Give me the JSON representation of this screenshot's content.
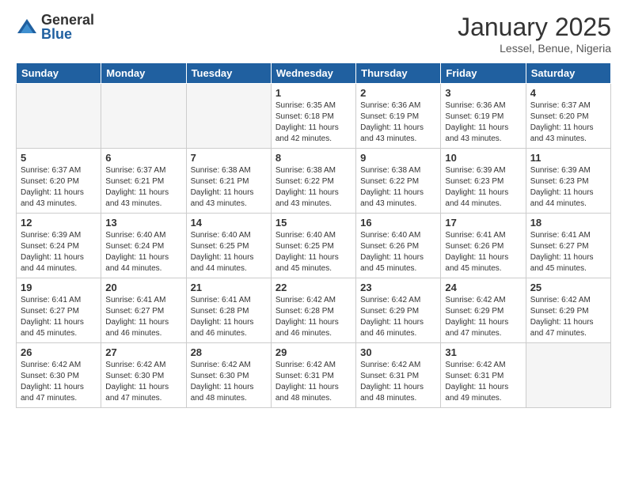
{
  "logo": {
    "general": "General",
    "blue": "Blue"
  },
  "header": {
    "month_year": "January 2025",
    "location": "Lessel, Benue, Nigeria"
  },
  "weekdays": [
    "Sunday",
    "Monday",
    "Tuesday",
    "Wednesday",
    "Thursday",
    "Friday",
    "Saturday"
  ],
  "weeks": [
    [
      {
        "day": "",
        "empty": true
      },
      {
        "day": "",
        "empty": true
      },
      {
        "day": "",
        "empty": true
      },
      {
        "day": "1",
        "sunrise": "6:35 AM",
        "sunset": "6:18 PM",
        "daylight": "11 hours and 42 minutes."
      },
      {
        "day": "2",
        "sunrise": "6:36 AM",
        "sunset": "6:19 PM",
        "daylight": "11 hours and 43 minutes."
      },
      {
        "day": "3",
        "sunrise": "6:36 AM",
        "sunset": "6:19 PM",
        "daylight": "11 hours and 43 minutes."
      },
      {
        "day": "4",
        "sunrise": "6:37 AM",
        "sunset": "6:20 PM",
        "daylight": "11 hours and 43 minutes."
      }
    ],
    [
      {
        "day": "5",
        "sunrise": "6:37 AM",
        "sunset": "6:20 PM",
        "daylight": "11 hours and 43 minutes."
      },
      {
        "day": "6",
        "sunrise": "6:37 AM",
        "sunset": "6:21 PM",
        "daylight": "11 hours and 43 minutes."
      },
      {
        "day": "7",
        "sunrise": "6:38 AM",
        "sunset": "6:21 PM",
        "daylight": "11 hours and 43 minutes."
      },
      {
        "day": "8",
        "sunrise": "6:38 AM",
        "sunset": "6:22 PM",
        "daylight": "11 hours and 43 minutes."
      },
      {
        "day": "9",
        "sunrise": "6:38 AM",
        "sunset": "6:22 PM",
        "daylight": "11 hours and 43 minutes."
      },
      {
        "day": "10",
        "sunrise": "6:39 AM",
        "sunset": "6:23 PM",
        "daylight": "11 hours and 44 minutes."
      },
      {
        "day": "11",
        "sunrise": "6:39 AM",
        "sunset": "6:23 PM",
        "daylight": "11 hours and 44 minutes."
      }
    ],
    [
      {
        "day": "12",
        "sunrise": "6:39 AM",
        "sunset": "6:24 PM",
        "daylight": "11 hours and 44 minutes."
      },
      {
        "day": "13",
        "sunrise": "6:40 AM",
        "sunset": "6:24 PM",
        "daylight": "11 hours and 44 minutes."
      },
      {
        "day": "14",
        "sunrise": "6:40 AM",
        "sunset": "6:25 PM",
        "daylight": "11 hours and 44 minutes."
      },
      {
        "day": "15",
        "sunrise": "6:40 AM",
        "sunset": "6:25 PM",
        "daylight": "11 hours and 45 minutes."
      },
      {
        "day": "16",
        "sunrise": "6:40 AM",
        "sunset": "6:26 PM",
        "daylight": "11 hours and 45 minutes."
      },
      {
        "day": "17",
        "sunrise": "6:41 AM",
        "sunset": "6:26 PM",
        "daylight": "11 hours and 45 minutes."
      },
      {
        "day": "18",
        "sunrise": "6:41 AM",
        "sunset": "6:27 PM",
        "daylight": "11 hours and 45 minutes."
      }
    ],
    [
      {
        "day": "19",
        "sunrise": "6:41 AM",
        "sunset": "6:27 PM",
        "daylight": "11 hours and 45 minutes."
      },
      {
        "day": "20",
        "sunrise": "6:41 AM",
        "sunset": "6:27 PM",
        "daylight": "11 hours and 46 minutes."
      },
      {
        "day": "21",
        "sunrise": "6:41 AM",
        "sunset": "6:28 PM",
        "daylight": "11 hours and 46 minutes."
      },
      {
        "day": "22",
        "sunrise": "6:42 AM",
        "sunset": "6:28 PM",
        "daylight": "11 hours and 46 minutes."
      },
      {
        "day": "23",
        "sunrise": "6:42 AM",
        "sunset": "6:29 PM",
        "daylight": "11 hours and 46 minutes."
      },
      {
        "day": "24",
        "sunrise": "6:42 AM",
        "sunset": "6:29 PM",
        "daylight": "11 hours and 47 minutes."
      },
      {
        "day": "25",
        "sunrise": "6:42 AM",
        "sunset": "6:29 PM",
        "daylight": "11 hours and 47 minutes."
      }
    ],
    [
      {
        "day": "26",
        "sunrise": "6:42 AM",
        "sunset": "6:30 PM",
        "daylight": "11 hours and 47 minutes."
      },
      {
        "day": "27",
        "sunrise": "6:42 AM",
        "sunset": "6:30 PM",
        "daylight": "11 hours and 47 minutes."
      },
      {
        "day": "28",
        "sunrise": "6:42 AM",
        "sunset": "6:30 PM",
        "daylight": "11 hours and 48 minutes."
      },
      {
        "day": "29",
        "sunrise": "6:42 AM",
        "sunset": "6:31 PM",
        "daylight": "11 hours and 48 minutes."
      },
      {
        "day": "30",
        "sunrise": "6:42 AM",
        "sunset": "6:31 PM",
        "daylight": "11 hours and 48 minutes."
      },
      {
        "day": "31",
        "sunrise": "6:42 AM",
        "sunset": "6:31 PM",
        "daylight": "11 hours and 49 minutes."
      },
      {
        "day": "",
        "empty": true
      }
    ]
  ]
}
